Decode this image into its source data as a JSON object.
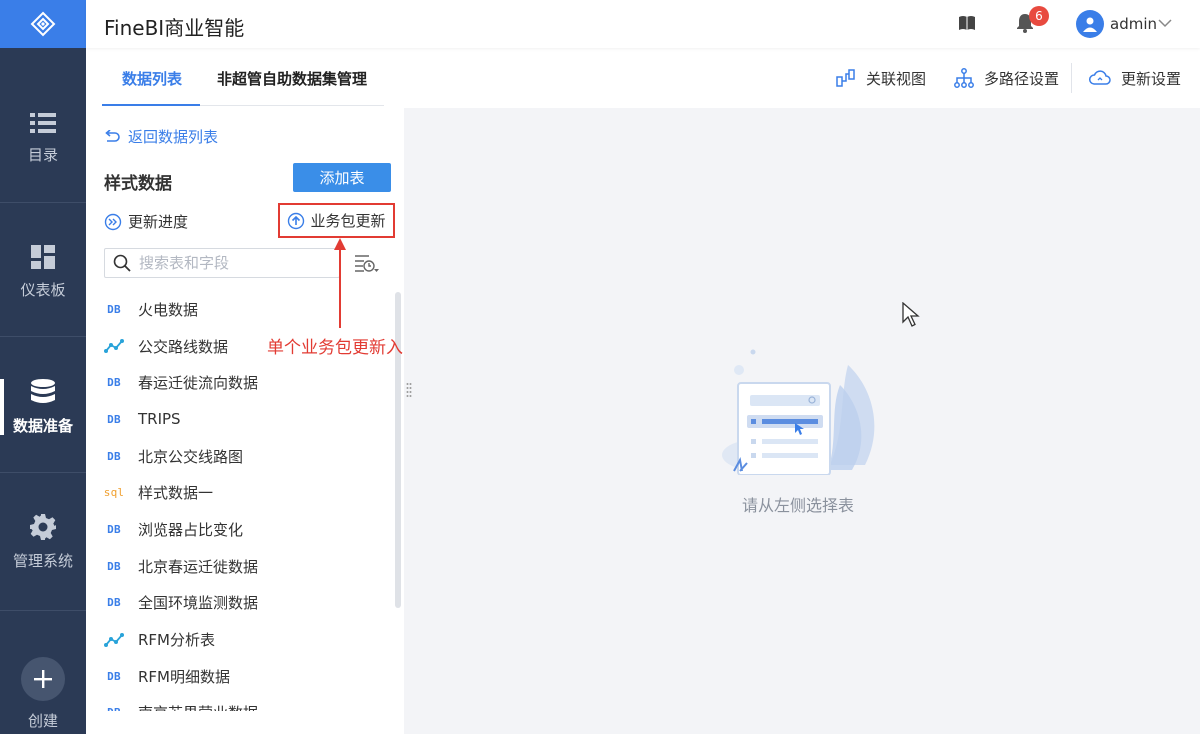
{
  "sidebar": {
    "items": [
      {
        "label": "目录",
        "icon": "list-icon",
        "active": false
      },
      {
        "label": "仪表板",
        "icon": "dashboard-icon",
        "active": false
      },
      {
        "label": "数据准备",
        "icon": "database-icon",
        "active": true
      },
      {
        "label": "管理系统",
        "icon": "gear-icon",
        "active": false
      }
    ],
    "create_label": "创建"
  },
  "header": {
    "title": "FineBI商业智能",
    "notification_count": "6",
    "user": "admin"
  },
  "tabs": [
    {
      "label": "数据列表",
      "active": true
    },
    {
      "label": "非超管自助数据集管理",
      "active": false
    }
  ],
  "toolbar": {
    "relation_view": "关联视图",
    "multipath": "多路径设置",
    "update_settings": "更新设置"
  },
  "panel": {
    "back_label": "返回数据列表",
    "title": "样式数据",
    "add_table": "添加表",
    "update_progress": "更新进度",
    "package_update": "业务包更新",
    "search_placeholder": "搜索表和字段"
  },
  "tables": [
    {
      "type": "DB",
      "name": "火电数据"
    },
    {
      "type": "self",
      "name": "公交路线数据"
    },
    {
      "type": "DB",
      "name": "春运迁徙流向数据"
    },
    {
      "type": "DB",
      "name": "TRIPS"
    },
    {
      "type": "DB",
      "name": "北京公交线路图"
    },
    {
      "type": "sql",
      "name": "样式数据一"
    },
    {
      "type": "DB",
      "name": "浏览器占比变化"
    },
    {
      "type": "DB",
      "name": "北京春运迁徙数据"
    },
    {
      "type": "DB",
      "name": "全国环境监测数据"
    },
    {
      "type": "self",
      "name": "RFM分析表"
    },
    {
      "type": "DB",
      "name": "RFM明细数据"
    },
    {
      "type": "DB",
      "name": "南京苏果营业数据"
    }
  ],
  "annotation": "单个业务包更新入口",
  "empty_state": "请从左侧选择表",
  "colors": {
    "accent": "#3a7ee8",
    "sidebar_bg": "#2b3a55",
    "highlight_red": "#e23b33",
    "sql_orange": "#f0a030"
  }
}
